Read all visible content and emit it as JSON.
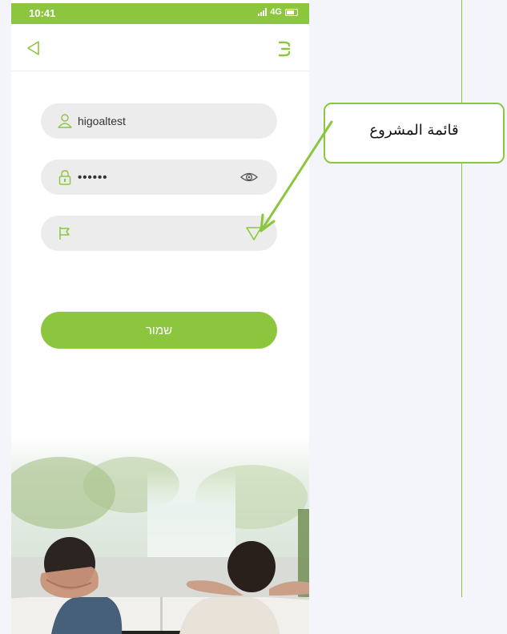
{
  "status_bar": {
    "time": "10:41",
    "network": "4G"
  },
  "login_form": {
    "username": "higoaltest",
    "password": "••••••",
    "project_value": ""
  },
  "save_button": {
    "label": "שמור"
  },
  "callout": {
    "text": "قائمة المشروع"
  },
  "colors": {
    "accent": "#8cc63f",
    "field_bg": "#ececec",
    "page_bg": "#f3f5fb"
  },
  "icons": [
    "back-icon",
    "menu-icon",
    "user-icon",
    "lock-icon",
    "eye-icon",
    "flag-icon",
    "dropdown-arrow-icon"
  ]
}
